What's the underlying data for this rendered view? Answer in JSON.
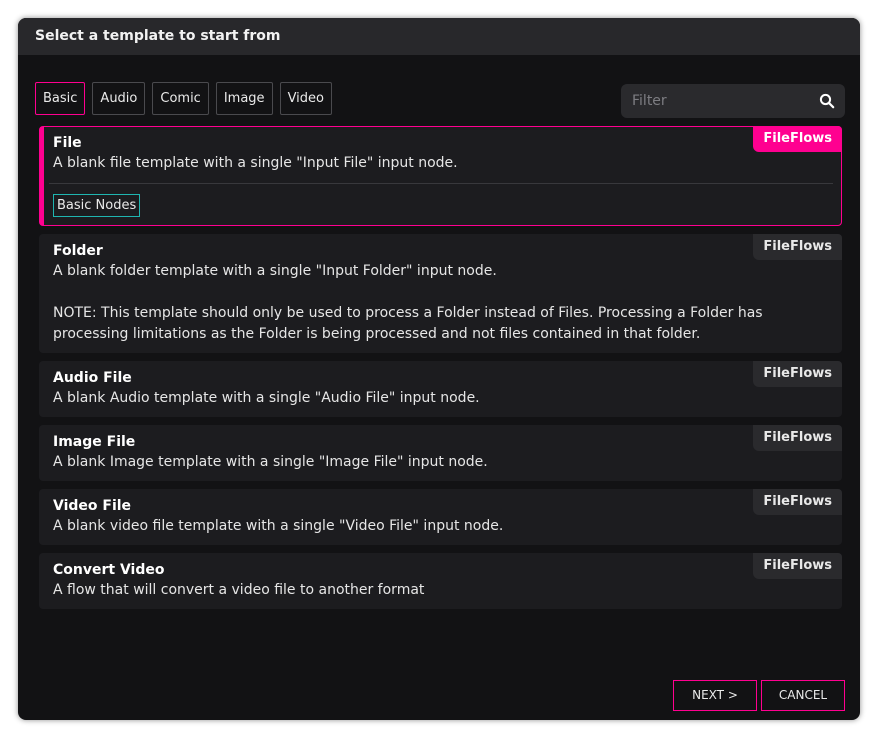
{
  "dialog": {
    "title": "Select a template to start from"
  },
  "tabs": [
    {
      "label": "Basic",
      "active": true
    },
    {
      "label": "Audio"
    },
    {
      "label": "Comic"
    },
    {
      "label": "Image"
    },
    {
      "label": "Video"
    }
  ],
  "filter": {
    "placeholder": "Filter",
    "value": ""
  },
  "templates": [
    {
      "title": "File",
      "description": "A blank file template with a single \"Input File\" input node.",
      "badge": "FileFlows",
      "tag": "Basic Nodes",
      "selected": true
    },
    {
      "title": "Folder",
      "description": "A blank folder template with a single \"Input Folder\" input node.\n\nNOTE: This template should only be used to process a Folder instead of Files. Processing a Folder has processing limitations as the Folder is being processed and not files contained in that folder.",
      "badge": "FileFlows"
    },
    {
      "title": "Audio File",
      "description": "A blank Audio template with a single \"Audio File\" input node.",
      "badge": "FileFlows"
    },
    {
      "title": "Image File",
      "description": "A blank Image template with a single \"Image File\" input node.",
      "badge": "FileFlows"
    },
    {
      "title": "Video File",
      "description": "A blank video file template with a single \"Video File\" input node.",
      "badge": "FileFlows"
    },
    {
      "title": "Convert Video",
      "description": "A flow that will convert a video file to another format",
      "badge": "FileFlows"
    }
  ],
  "footer": {
    "next_label": "NEXT >",
    "cancel_label": "CANCEL"
  },
  "colors": {
    "accent": "#ff0090",
    "tag_border": "#1fb5b0",
    "background": "#121214"
  },
  "icons": {
    "search": "search-icon"
  }
}
